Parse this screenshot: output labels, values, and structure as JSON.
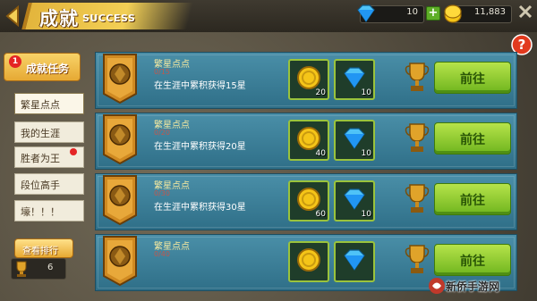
{
  "header": {
    "title": "成就",
    "subtitle": "SUCCESS",
    "diamonds": "10",
    "coins": "11,883"
  },
  "sidebar": {
    "top_tab": {
      "label": "成就任务",
      "badge": "1"
    },
    "items": [
      {
        "label": "繁星点点",
        "active": true,
        "dot": false
      },
      {
        "label": "我的生涯",
        "active": false,
        "dot": false
      },
      {
        "label": "胜者为王",
        "active": false,
        "dot": true
      },
      {
        "label": "段位高手",
        "active": false,
        "dot": false
      },
      {
        "label": "壕！！！",
        "active": false,
        "dot": false
      }
    ],
    "rank_button": "查看排行",
    "rank_value": "6"
  },
  "achievements": [
    {
      "name": "繁星点点",
      "progress": "0/15",
      "desc": "在生涯中累积获得15星",
      "coins": "20",
      "diamonds": "10",
      "action": "前往"
    },
    {
      "name": "繁星点点",
      "progress": "0/20",
      "desc": "在生涯中累积获得20星",
      "coins": "40",
      "diamonds": "10",
      "action": "前往"
    },
    {
      "name": "繁星点点",
      "progress": "0/30",
      "desc": "在生涯中累积获得30星",
      "coins": "60",
      "diamonds": "10",
      "action": "前往"
    },
    {
      "name": "繁星点点",
      "progress": "0/40",
      "desc": "",
      "coins": "",
      "diamonds": "",
      "action": "前往"
    }
  ],
  "watermark": "新侨手游网",
  "colors": {
    "row": "#3a7f98",
    "go_button": "#8fcb2e",
    "title_gold": "#f2cf55"
  }
}
